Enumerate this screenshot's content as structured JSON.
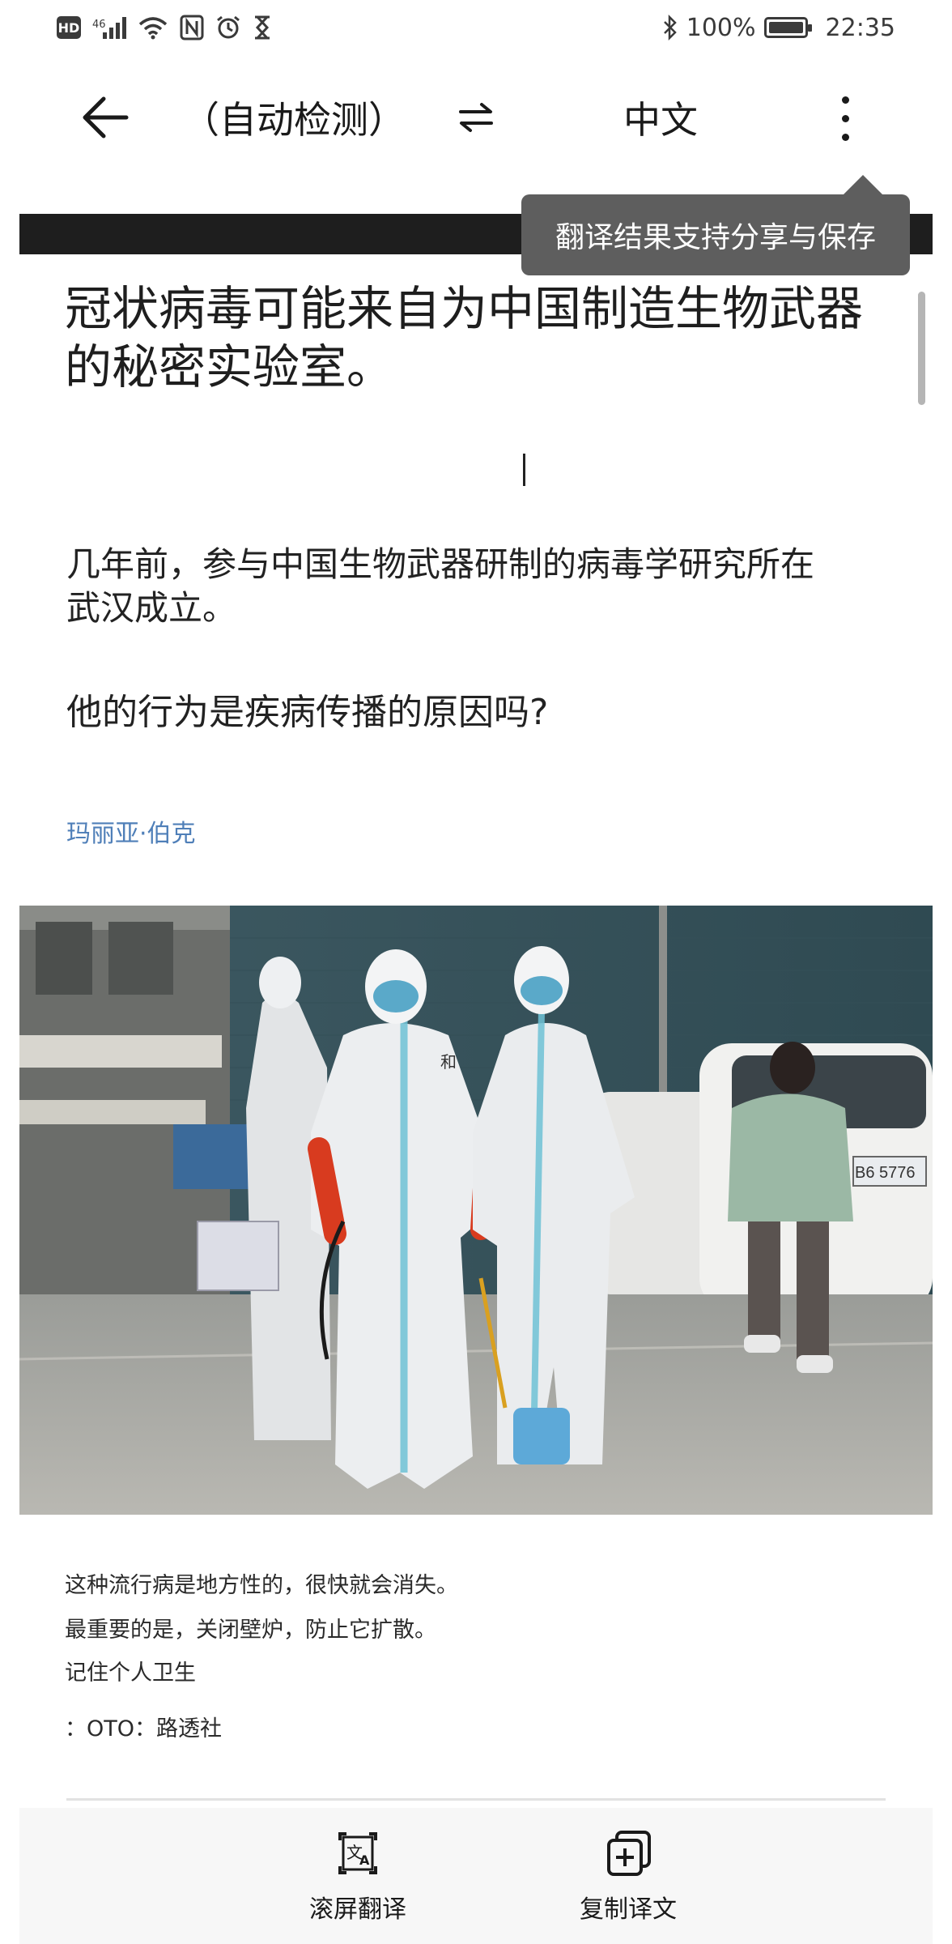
{
  "status_bar": {
    "left_icons": [
      "hd-icon",
      "signal-4g-icon",
      "wifi-icon",
      "nfc-icon",
      "alarm-icon",
      "hourglass-icon"
    ],
    "network_label": "46",
    "hd_label": "HD",
    "bluetooth_icon": "bluetooth-icon",
    "battery_percent": "100%",
    "time": "22:35"
  },
  "toolbar": {
    "source_language": "（自动检测）",
    "target_language": "中文",
    "icons": {
      "back": "arrow-left-icon",
      "swap": "swap-arrows-icon",
      "more": "more-vertical-icon"
    }
  },
  "tooltip": {
    "text": "翻译结果支持分享与保存"
  },
  "article": {
    "title": "冠状病毒可能来自为中国制造生物武器的秘密实验室。",
    "paragraph1": "几年前，参与中国生物武器研制的病毒学研究所在武汉成立。",
    "paragraph2": "他的行为是疾病传播的原因吗?",
    "author": "玛丽亚·伯克",
    "photo": {
      "description_icon": "news-photo",
      "vest_text": "和",
      "plate_text": "B6 5776"
    },
    "captions": [
      "这种流行病是地方性的，很快就会消失。",
      "最重要的是，关闭壁炉，防止它扩散。",
      "记住个人卫生",
      "：OTO：路透社"
    ]
  },
  "bottom_bar": {
    "scroll_translate_label": "滚屏翻译",
    "copy_translation_label": "复制译文",
    "icons": {
      "scroll_translate": "translate-screen-icon",
      "copy": "copy-add-icon"
    }
  },
  "colors": {
    "tooltip_bg": "#5e5e5e",
    "author_link": "#4f7fb8",
    "bottom_bar_bg": "#f7f7f7"
  }
}
